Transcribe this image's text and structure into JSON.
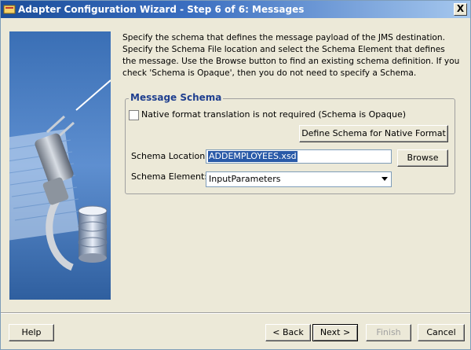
{
  "window": {
    "title": "Adapter Configuration Wizard - Step 6 of 6: Messages",
    "close_label": "X"
  },
  "description": "Specify the schema that defines the message payload of the JMS destination.  Specify the Schema File location and select the Schema Element that defines the message. Use the Browse button to find an existing schema definition. If you check 'Schema is Opaque', then you do not need to specify a Schema.",
  "schema_group": {
    "title": "Message Schema",
    "opaque_checkbox_label": "Native format translation is not required (Schema is Opaque)",
    "opaque_checked": false,
    "define_button": "Define Schema for Native Format",
    "location_label": "Schema Location:",
    "location_value": "ADDEMPLOYEES.xsd",
    "browse_button": "Browse",
    "element_label": "Schema Element:",
    "element_value": "InputParameters"
  },
  "footer": {
    "help": "Help",
    "back": "< Back",
    "next": "Next >",
    "finish": "Finish",
    "cancel": "Cancel"
  },
  "icons": {
    "title": "wizard-icon",
    "side": "plug-database-illustration"
  }
}
